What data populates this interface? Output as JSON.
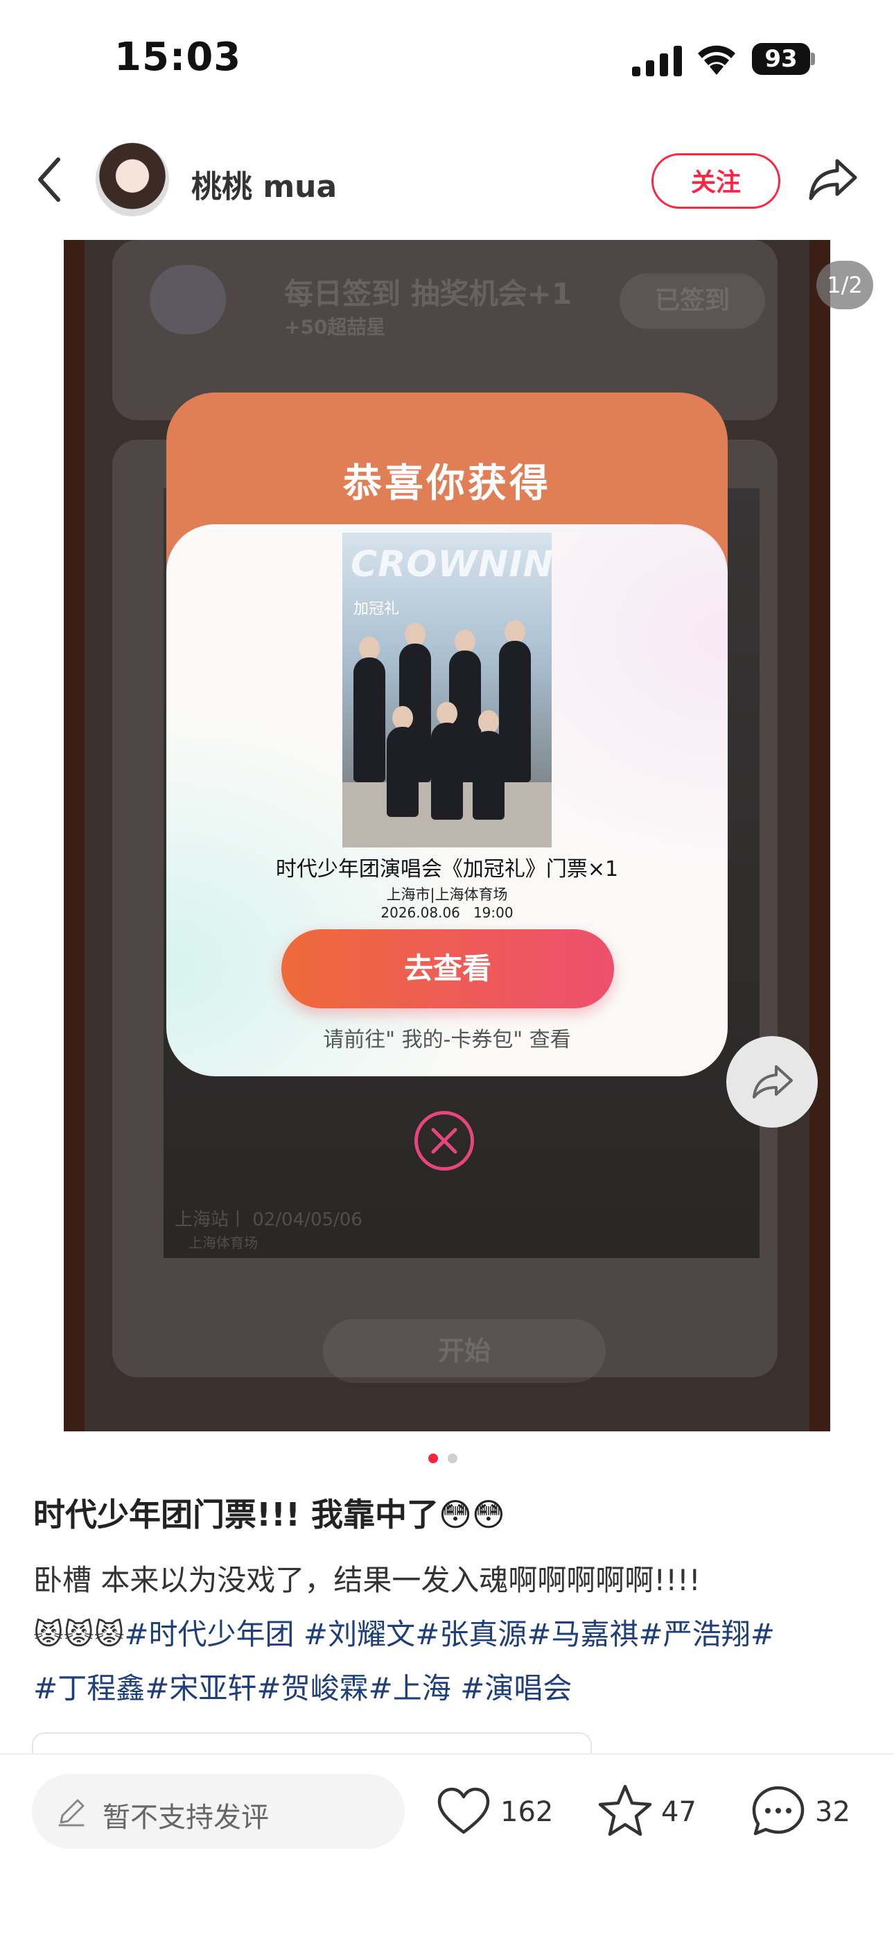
{
  "status_bar": {
    "time": "15:03",
    "battery": "93"
  },
  "header": {
    "username": "桃桃 mua",
    "follow_label": "关注"
  },
  "image_viewer": {
    "page_indicator": "1/2",
    "background": {
      "checkin_title": "每日签到 抽奖机会+1",
      "checkin_sub": "+50超喆星",
      "checked_label": "已签到",
      "start_label": "开始",
      "photo_caption": "上海站丨 02/04/05/06",
      "photo_venue": "上海体育场"
    },
    "modal": {
      "title": "恭喜你获得",
      "poster_title": "CROWNING",
      "poster_subtitle": "加冠礼",
      "prize_name": "时代少年团演唱会《加冠礼》门票×1",
      "venue": "上海市|上海体育场",
      "datetime": "2026.08.06   19:00",
      "go_button": "去查看",
      "hint": "请前往\" 我的-卡券包\" 查看"
    }
  },
  "post": {
    "title": "时代少年团门票!!! 我靠中了😳😳",
    "body_line1": "卧槽 本来以为没戏了，结果一发入魂啊啊啊啊啊!!!!",
    "emoji_prefix": "😾😾😾",
    "hashtags": [
      "#时代少年团",
      "#刘耀文",
      "#张真源",
      "#马嘉祺",
      "#严浩翔",
      "#丁程鑫",
      "#宋亚轩",
      "#贺峻霖",
      "#上海",
      "#演唱会"
    ]
  },
  "bottom_bar": {
    "comment_placeholder": "暂不支持发评",
    "likes": "162",
    "favorites": "47",
    "comments": "32"
  },
  "colors": {
    "accent": "#ff2442",
    "modal_header": "#e07e56",
    "hashtag": "#1f3f7a"
  }
}
